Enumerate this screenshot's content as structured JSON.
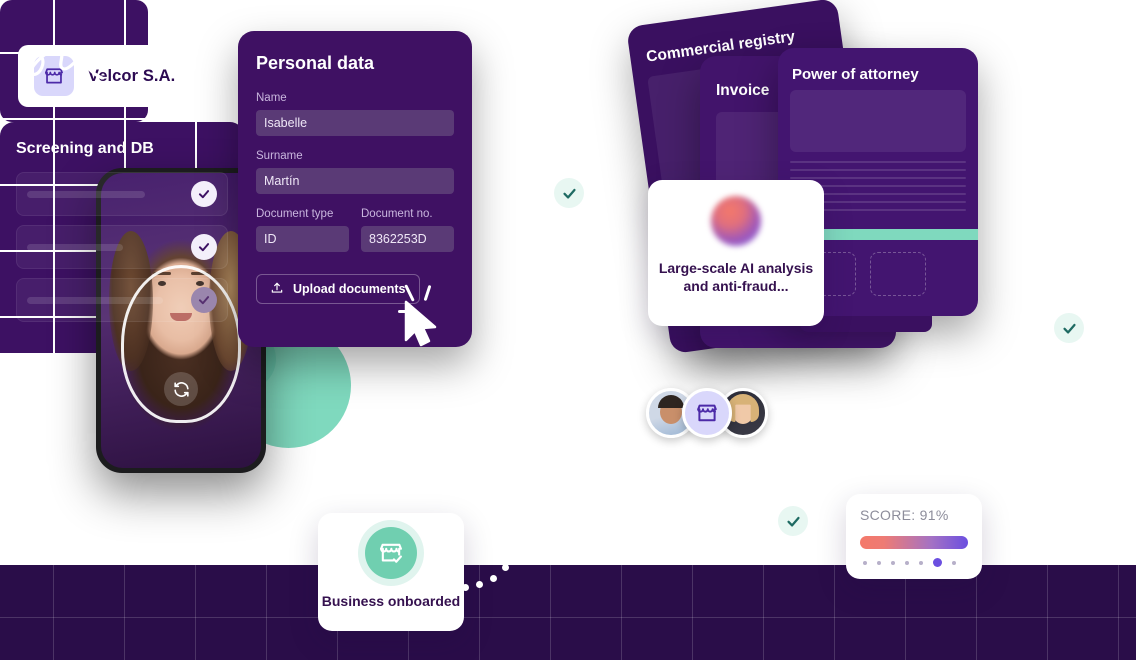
{
  "brand_badge": {
    "name": "Velcor S.A.",
    "icon": "store-icon",
    "chip_color": "#d9d7fb",
    "icon_color": "#4c2aa8"
  },
  "personal_data_card": {
    "title": "Personal data",
    "fields": [
      {
        "label": "Name",
        "value": "Isabelle"
      },
      {
        "label": "Surname",
        "value": "Martín"
      },
      {
        "label": "Document type",
        "value": "ID"
      },
      {
        "label": "Document no.",
        "value": "8362253D"
      }
    ],
    "upload_button": "Upload documents",
    "upload_icon": "upload-icon",
    "background": "#3f1163"
  },
  "phone": {
    "liveness_overlay": "face-oval-guide",
    "flip_camera_icon": "camera-flip-icon"
  },
  "documents": [
    {
      "title": "Commercial registry"
    },
    {
      "title": "Invoice"
    },
    {
      "title": "Power of attorney"
    }
  ],
  "ai_card": {
    "text": "Large-scale AI analysis and anti-fraud...",
    "orb_icon": "gradient-orb-icon"
  },
  "signature_card": {
    "signature_icon": "handwritten-signature-icon"
  },
  "avatars": [
    {
      "name": "avatar-man"
    },
    {
      "name": "avatar-store-logo"
    },
    {
      "name": "avatar-woman"
    }
  ],
  "business_card": {
    "text": "Business onboarded",
    "icon": "store-check-icon",
    "circle_color": "#70cfb0"
  },
  "screening_panel": {
    "title": "Screening and DB",
    "rows": [
      {
        "state": "verified",
        "check_icon": "check-icon"
      },
      {
        "state": "verified",
        "check_icon": "check-icon"
      },
      {
        "state": "pending",
        "check_icon": "check-icon"
      }
    ]
  },
  "score_card": {
    "label": "SCORE: 91%",
    "value": 91,
    "gradient_from": "#f4796a",
    "gradient_to": "#6b4fe0",
    "dots_total": 7,
    "dot_active_index": 6
  },
  "status_checks": [
    {
      "name": "check-badge-1"
    },
    {
      "name": "check-badge-2"
    },
    {
      "name": "check-badge-3"
    }
  ],
  "colors": {
    "purple_card": "#3d1163",
    "deep_purple_band": "#2a0d49",
    "teal": "#7fd9be",
    "accent_indigo": "#6b4fe0",
    "accent_coral": "#f4796a"
  }
}
